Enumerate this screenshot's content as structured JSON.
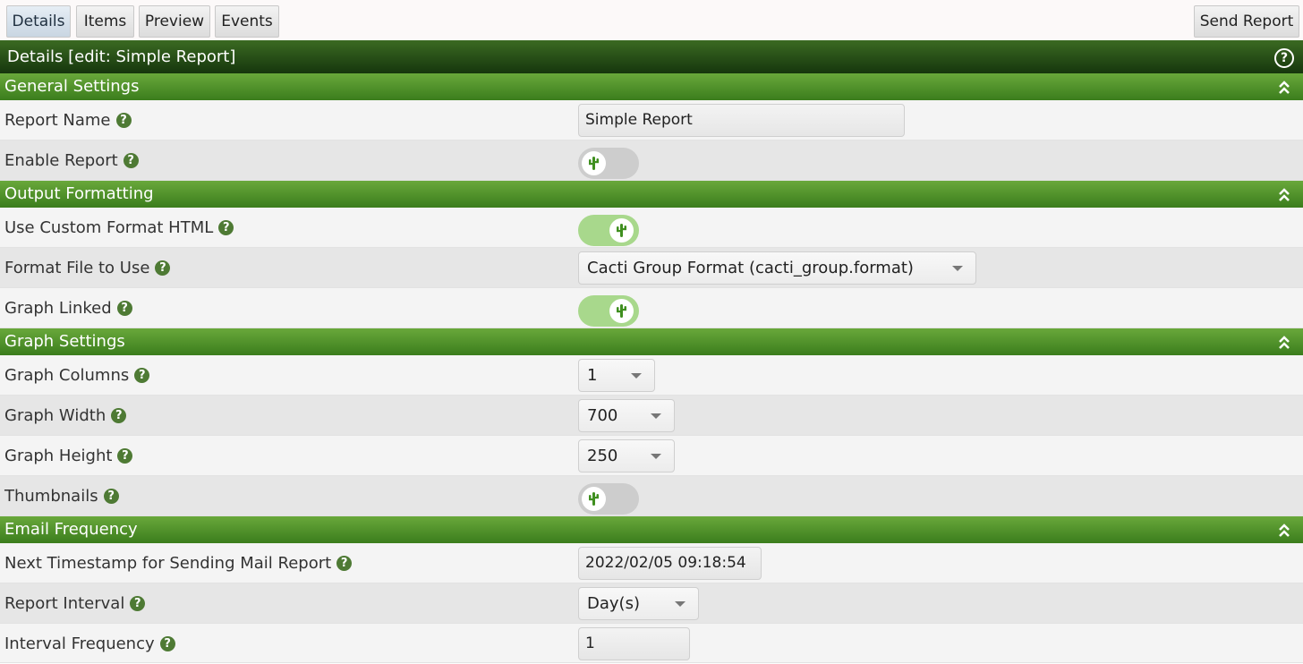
{
  "tabs": [
    {
      "label": "Details",
      "active": true
    },
    {
      "label": "Items",
      "active": false
    },
    {
      "label": "Preview",
      "active": false
    },
    {
      "label": "Events",
      "active": false
    }
  ],
  "send_report_label": "Send Report",
  "panel_title": "Details [edit: Simple Report]",
  "help_glyph": "?",
  "hint_glyph": "?",
  "sections": {
    "general": "General Settings",
    "output": "Output Formatting",
    "graph": "Graph Settings",
    "email": "Email Frequency"
  },
  "fields": {
    "report_name": {
      "label": "Report Name",
      "value": "Simple Report"
    },
    "enable_report": {
      "label": "Enable Report",
      "checked": false
    },
    "custom_format": {
      "label": "Use Custom Format HTML",
      "checked": true
    },
    "format_file": {
      "label": "Format File to Use",
      "value": "Cacti Group Format (cacti_group.format)"
    },
    "graph_linked": {
      "label": "Graph Linked",
      "checked": true
    },
    "graph_columns": {
      "label": "Graph Columns",
      "value": "1"
    },
    "graph_width": {
      "label": "Graph Width",
      "value": "700"
    },
    "graph_height": {
      "label": "Graph Height",
      "value": "250"
    },
    "thumbnails": {
      "label": "Thumbnails",
      "checked": false
    },
    "next_timestamp": {
      "label": "Next Timestamp for Sending Mail Report",
      "value": "2022/02/05 09:18:54"
    },
    "report_interval": {
      "label": "Report Interval",
      "value": "Day(s)"
    },
    "interval_frequency": {
      "label": "Interval Frequency",
      "value": "1"
    }
  },
  "colors": {
    "header_dark": "#16360d",
    "section_green": "#4e8c2a",
    "toggle_on": "#a8d88c",
    "toggle_off": "#cdcdcd"
  }
}
